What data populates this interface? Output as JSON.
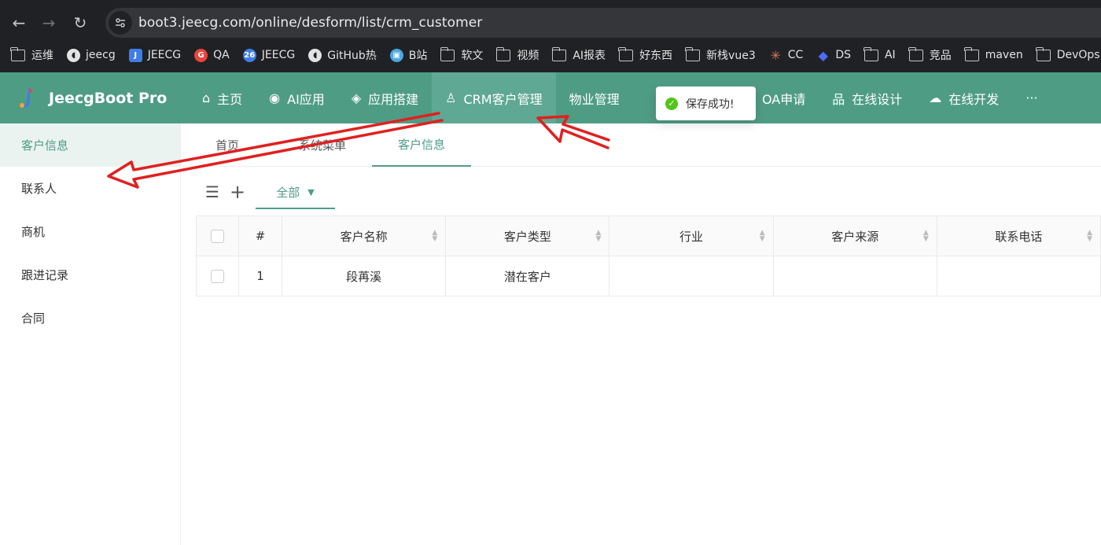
{
  "browser": {
    "url": "boot3.jeecg.com/online/desform/list/crm_customer",
    "bookmarks": [
      {
        "label": "运维",
        "icon": "folder-icon"
      },
      {
        "label": "jeecg",
        "icon": "github-icon"
      },
      {
        "label": "JEECG",
        "icon": "jeecg-icon"
      },
      {
        "label": "QA",
        "icon": "g-icon"
      },
      {
        "label": "JEECG",
        "icon": "jeecg-26-icon"
      },
      {
        "label": "GitHub热",
        "icon": "github-icon"
      },
      {
        "label": "B站",
        "icon": "bilibili-icon"
      },
      {
        "label": "软文",
        "icon": "folder-icon"
      },
      {
        "label": "视频",
        "icon": "folder-icon"
      },
      {
        "label": "AI报表",
        "icon": "folder-icon"
      },
      {
        "label": "好东西",
        "icon": "folder-icon"
      },
      {
        "label": "新栈vue3",
        "icon": "folder-icon"
      },
      {
        "label": "CC",
        "icon": "claude-icon"
      },
      {
        "label": "DS",
        "icon": "deepseek-icon"
      },
      {
        "label": "AI",
        "icon": "folder-icon"
      },
      {
        "label": "竞品",
        "icon": "folder-icon"
      },
      {
        "label": "maven",
        "icon": "folder-icon"
      },
      {
        "label": "DevOps",
        "icon": "folder-icon"
      }
    ]
  },
  "app": {
    "logo_text": "JeecgBoot Pro",
    "nav": [
      {
        "label": "主页",
        "icon": "home-icon",
        "active": false
      },
      {
        "label": "AI应用",
        "icon": "ai-icon",
        "active": false
      },
      {
        "label": "应用搭建",
        "icon": "codepen-icon",
        "active": false
      },
      {
        "label": "CRM客户管理",
        "icon": "user-icon",
        "active": true
      },
      {
        "label": "物业管理",
        "icon": "",
        "active": false
      },
      {
        "label": "",
        "icon": "",
        "active": false
      },
      {
        "label": "OA申请",
        "icon": "team-icon",
        "active": false
      },
      {
        "label": "在线设计",
        "icon": "cluster-icon",
        "active": false
      },
      {
        "label": "在线开发",
        "icon": "cloud-icon",
        "active": false
      },
      {
        "label": "···",
        "icon": "",
        "active": false
      }
    ],
    "more": "···"
  },
  "toast": {
    "message": "保存成功!"
  },
  "sidebar": {
    "items": [
      {
        "label": "客户信息",
        "active": true
      },
      {
        "label": "联系人",
        "active": false
      },
      {
        "label": "商机",
        "active": false
      },
      {
        "label": "跟进记录",
        "active": false
      },
      {
        "label": "合同",
        "active": false
      }
    ]
  },
  "tabs": [
    {
      "label": "首页",
      "active": false
    },
    {
      "label": "系统菜单",
      "active": false
    },
    {
      "label": "客户信息",
      "active": true
    }
  ],
  "toolbar": {
    "filter_label": "全部"
  },
  "table": {
    "columns": [
      "#",
      "客户名称",
      "客户类型",
      "行业",
      "客户来源",
      "联系电话"
    ],
    "rows": [
      {
        "index": "1",
        "name": "段苒溪",
        "type": "潜在客户",
        "industry": "",
        "source": "",
        "phone": ""
      }
    ]
  },
  "colors": {
    "brand": "#4f9c85",
    "annotation": "#e02020",
    "success": "#52c41a"
  }
}
